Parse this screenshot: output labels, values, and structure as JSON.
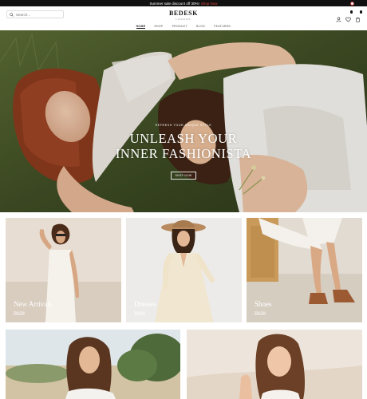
{
  "announcement": {
    "text": "Summer sale discount off 30%!",
    "link": "Shop Now"
  },
  "search": {
    "placeholder": "Search..."
  },
  "logo": {
    "brand": "BEDESK",
    "sub": "LONDON"
  },
  "header_icons": [
    "user-icon",
    "heart-icon",
    "cart-icon"
  ],
  "nav": [
    "HOME",
    "SHOP",
    "PRODUCT",
    "BLOG",
    "FEATURED"
  ],
  "hero": {
    "eyebrow": "REFRESH YOUR UNIQUE STYLE",
    "headline_line1": "UNLEASH YOUR",
    "headline_line2": "INNER FASHIONISTA",
    "button": "SHOP NOW",
    "slides": 3,
    "active_slide": 2
  },
  "categories": [
    {
      "title": "New Arrivals",
      "link": "Shop Now"
    },
    {
      "title": "Dresses",
      "link": "Shop Now"
    },
    {
      "title": "Shoes",
      "link": "Shop Now"
    }
  ],
  "colors": {
    "topbar": "#111111",
    "accent": "#e0443b",
    "text": "#222222"
  }
}
